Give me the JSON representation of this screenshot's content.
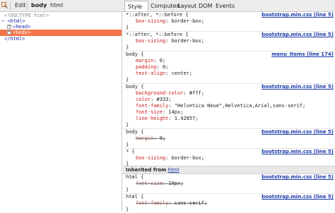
{
  "toolbar": {
    "edit_label": "Edit",
    "crumbs": [
      "body",
      "html"
    ],
    "tabs": [
      {
        "label": "Style",
        "caret": "▾"
      },
      {
        "label": "Computed"
      },
      {
        "label": "Layout"
      },
      {
        "label": "DOM"
      },
      {
        "label": "Events"
      }
    ]
  },
  "html_tree": {
    "doctype": "<!DOCTYPE html>",
    "html_open": "<html>",
    "head": "<head>",
    "body": "<body>",
    "html_close": "</html>"
  },
  "styles": {
    "rules": [
      {
        "selector": "*::after, *::before {",
        "source": "bootstrap.min.css (line 5)",
        "props": [
          {
            "name": "box-sizing",
            "value": "border-box;"
          }
        ],
        "close": "}"
      },
      {
        "selector": "*::after, *::before {",
        "source": "bootstrap.min.css (line 5)",
        "props": [
          {
            "name": "box-sizing",
            "value": "border-box;"
          }
        ],
        "close": "}"
      },
      {
        "selector": "body {",
        "source": "menu_items (line 174)",
        "props": [
          {
            "name": "margin",
            "value": "0;"
          },
          {
            "name": "padding",
            "value": "0;"
          },
          {
            "name": "text-align",
            "value": "center;"
          }
        ],
        "close": "}"
      },
      {
        "selector": "body {",
        "source": "bootstrap.min.css (line 5)",
        "props": [
          {
            "name": "background-color",
            "value": "#fff;"
          },
          {
            "name": "color",
            "value": "#333;"
          },
          {
            "name": "font-family",
            "value": "\"Helvetica Neue\",Helvetica,Arial,sans-serif;"
          },
          {
            "name": "font-size",
            "value": "14px;"
          },
          {
            "name": "line-height",
            "value": "1.42857;"
          }
        ],
        "close": "}"
      },
      {
        "selector": "body {",
        "source": "bootstrap.min.css (line 5)",
        "props": [
          {
            "name": "margin",
            "value": "0;"
          }
        ],
        "close": "}"
      },
      {
        "selector": "* {",
        "source": "bootstrap.min.css (line 5)",
        "props": [
          {
            "name": "box-sizing",
            "value": "border-box;"
          }
        ],
        "close": "}"
      }
    ],
    "inherited_label": "Inherited from",
    "inherited_link": "html",
    "inherited_rules": [
      {
        "selector": "html {",
        "source": "bootstrap.min.css (line 5)",
        "props": [
          {
            "name": "font-size",
            "value": "10px;"
          }
        ],
        "close": "}"
      },
      {
        "selector": "html {",
        "source": "bootstrap.min.css (line 5)",
        "props": [
          {
            "name": "font-family",
            "value": "sans-serif;"
          }
        ],
        "close": "}"
      }
    ]
  }
}
